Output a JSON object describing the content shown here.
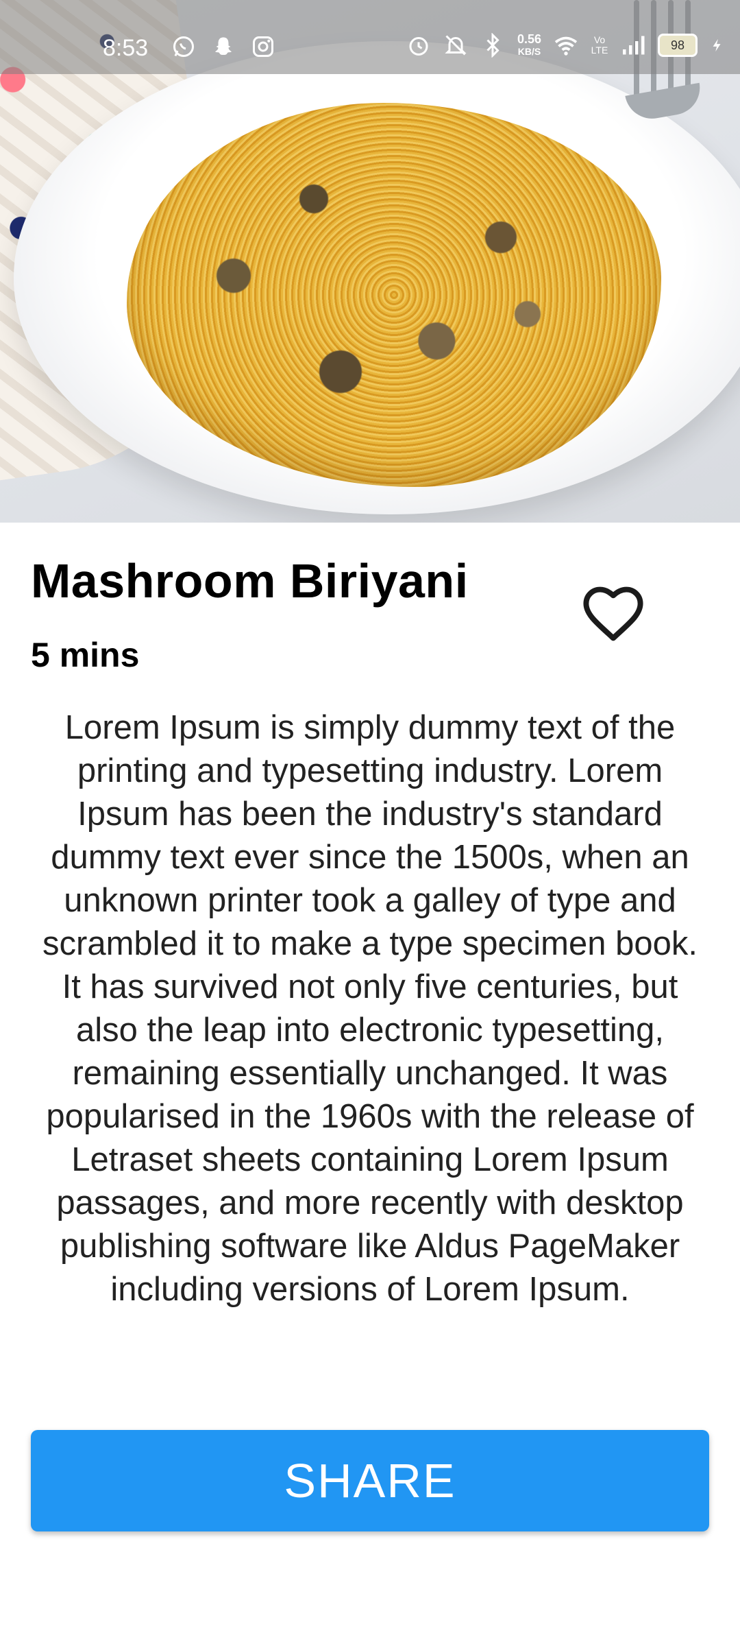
{
  "status_bar": {
    "time": "8:53",
    "network_speed_value": "0.56",
    "network_speed_unit": "KB/S",
    "volte_label": "Vo LTE",
    "battery_level": "98",
    "icons": [
      "whatsapp-icon",
      "snapchat-icon",
      "instagram-icon",
      "alarm-icon",
      "mute-icon",
      "bluetooth-icon",
      "wifi-icon",
      "signal-icon",
      "battery-icon",
      "charging-icon"
    ]
  },
  "hero": {
    "image_subject": "mushroom-biriyani-plate"
  },
  "recipe": {
    "title": "Mashroom Biriyani",
    "duration": "5 mins",
    "description": "Lorem Ipsum is simply dummy text of the printing and typesetting industry. Lorem Ipsum has been the industry's standard dummy text ever since the 1500s, when an unknown printer took a galley of type and scrambled it to make a type specimen book. It has survived not only five centuries, but also the leap into electronic typesetting, remaining essentially unchanged. It was popularised in the 1960s with the release of Letraset sheets containing Lorem Ipsum passages, and more recently with desktop publishing software like Aldus PageMaker including versions of Lorem Ipsum."
  },
  "actions": {
    "share_label": "SHARE",
    "favorite_icon": "heart-outline-icon"
  },
  "colors": {
    "primary": "#2196f3",
    "text": "#000000",
    "background": "#ffffff"
  }
}
